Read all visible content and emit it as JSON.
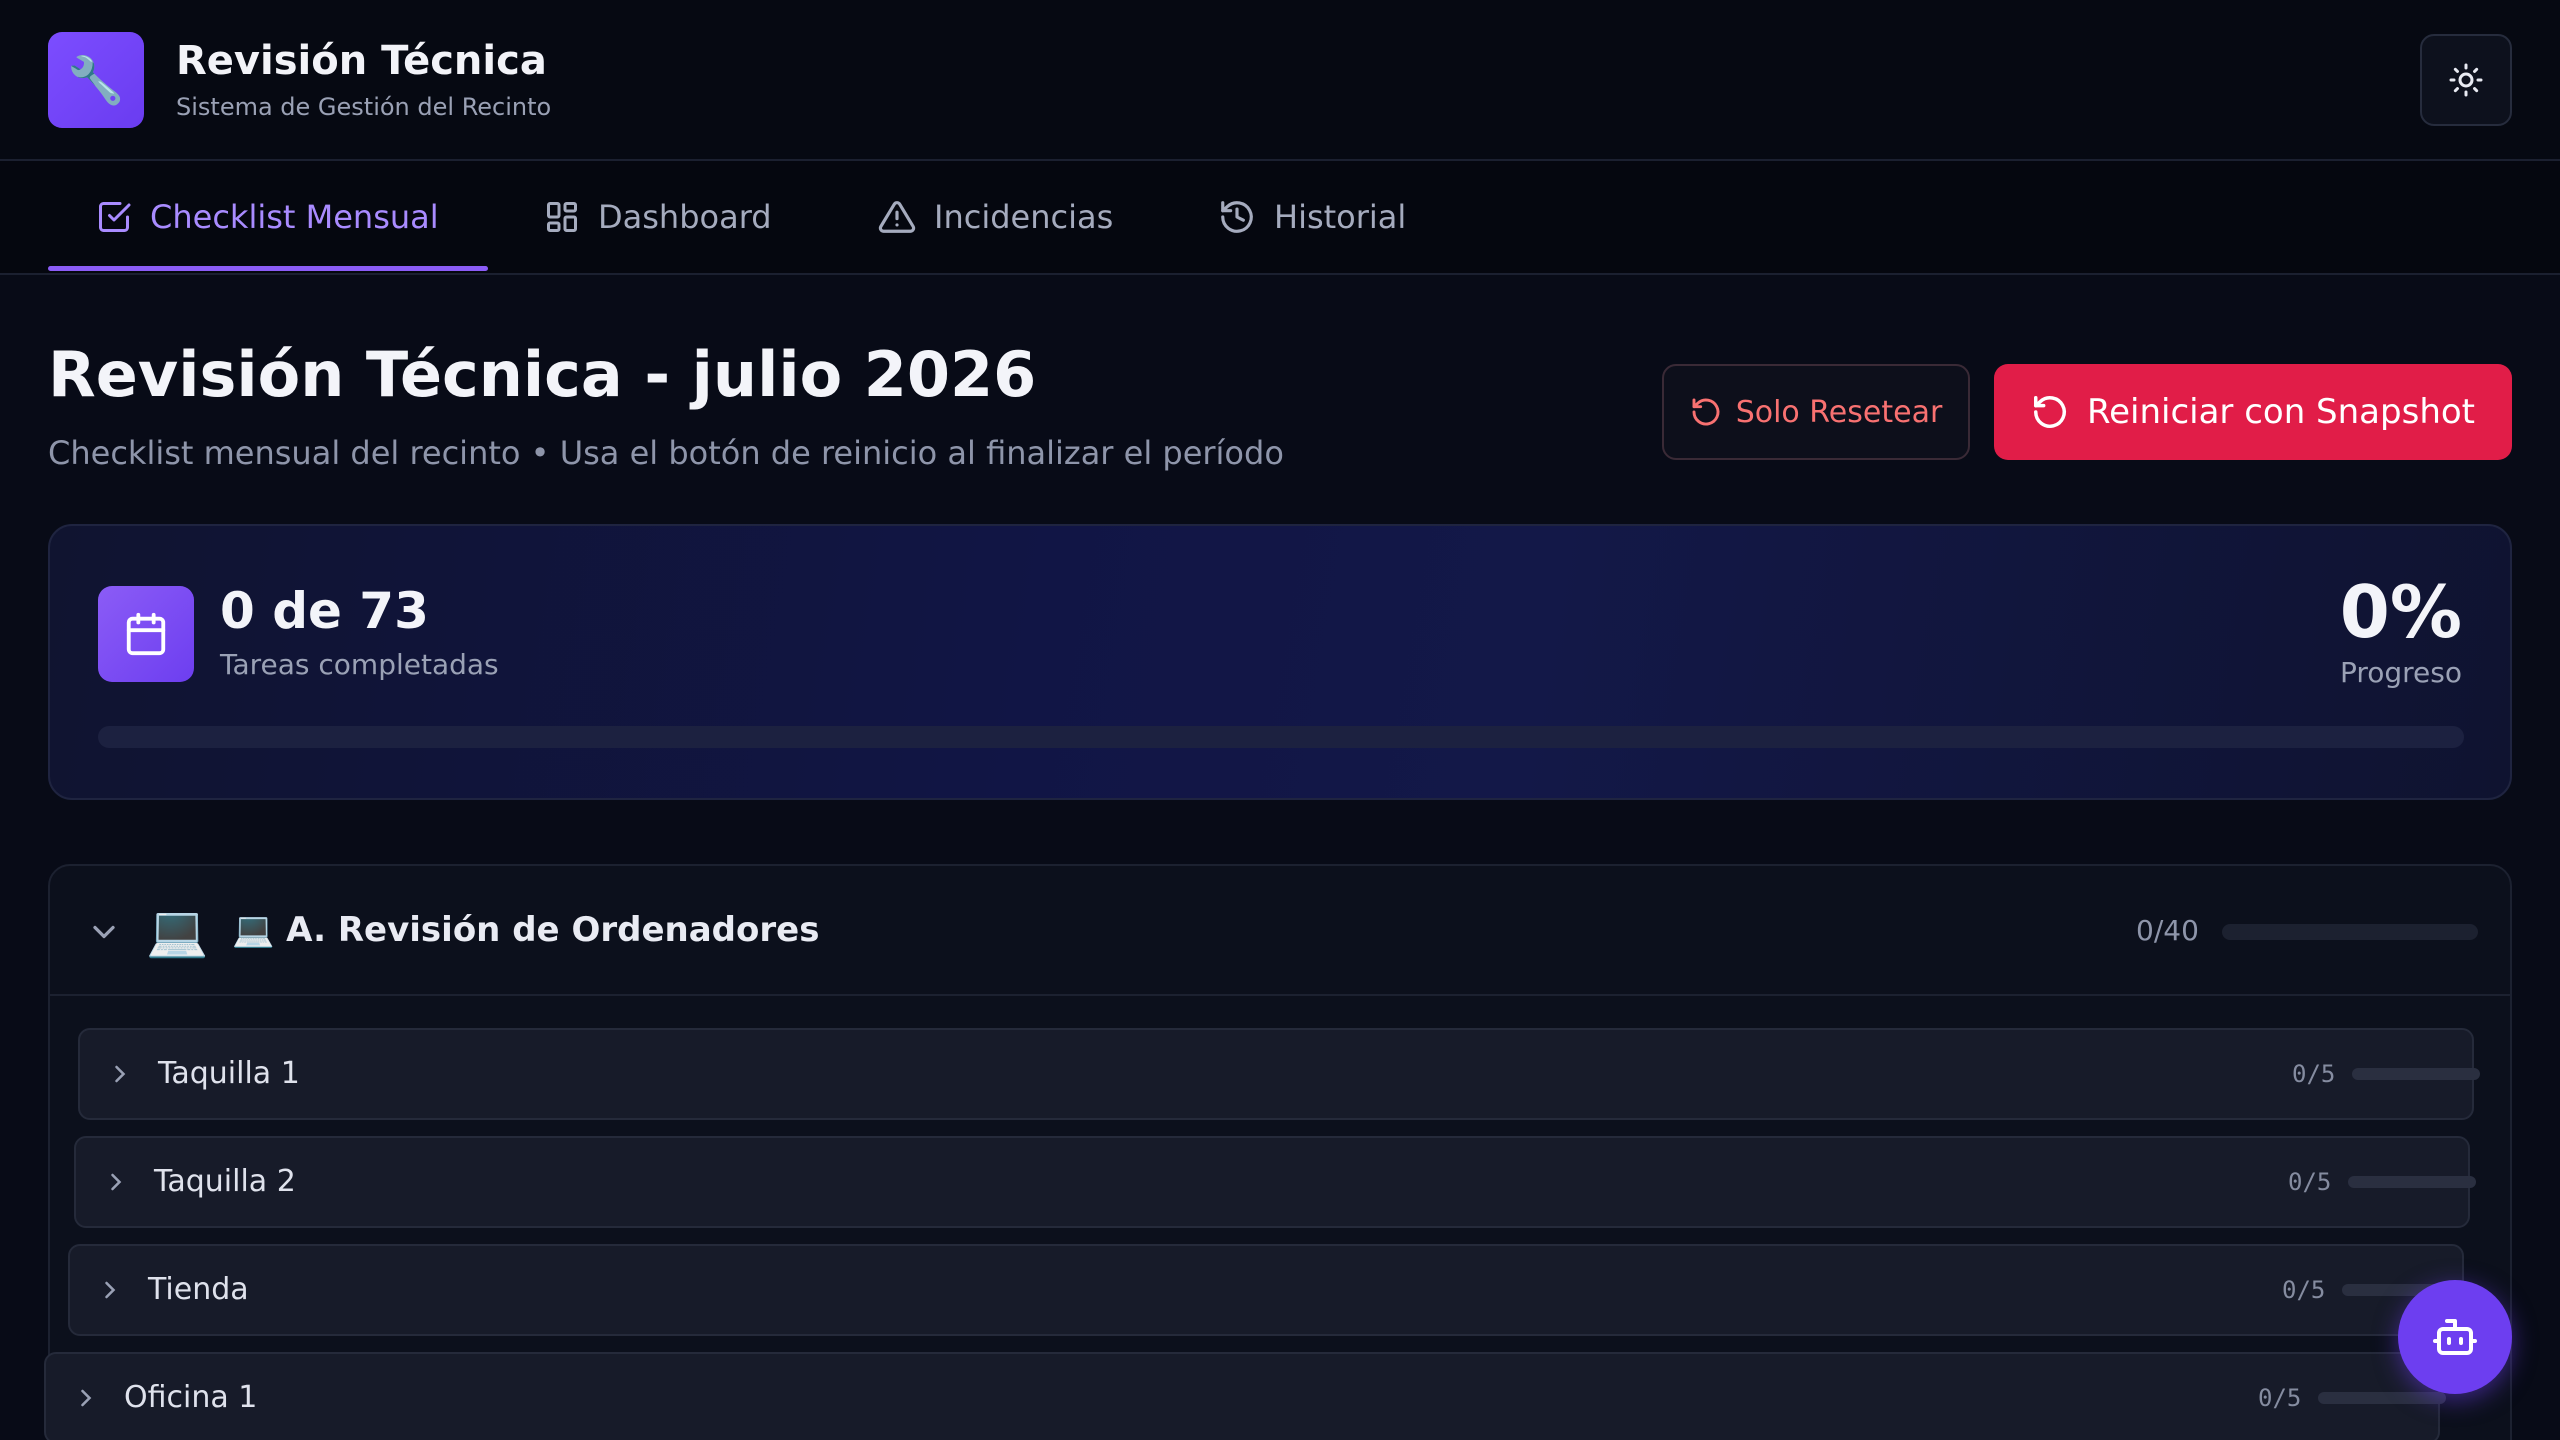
{
  "header": {
    "logo_glyph": "🔧",
    "title": "Revisión Técnica",
    "subtitle": "Sistema de Gestión del Recinto",
    "theme_icon": "sun-icon"
  },
  "tabs": [
    {
      "label": "Checklist Mensual",
      "icon": "checkbox-icon",
      "active": true
    },
    {
      "label": "Dashboard",
      "icon": "grid-icon",
      "active": false
    },
    {
      "label": "Incidencias",
      "icon": "warning-icon",
      "active": false
    },
    {
      "label": "Historial",
      "icon": "history-icon",
      "active": false
    }
  ],
  "page": {
    "title": "Revisión Técnica - julio 2026",
    "subtitle": "Checklist mensual del recinto • Usa el botón de reinicio al finalizar el período",
    "reset_label": "Solo Resetear",
    "snapshot_label": "Reiniciar con Snapshot"
  },
  "progress": {
    "done_text": "0 de 73",
    "done_label": "Tareas completadas",
    "percent_text": "0%",
    "percent_label": "Progreso",
    "fraction": 0
  },
  "section": {
    "emoji": "💻",
    "title": "💻 A. Revisión de Ordenadores",
    "count": "0/40",
    "fraction": 0,
    "rows": [
      {
        "label": "Taquilla 1",
        "count": "0/5",
        "fraction": 0
      },
      {
        "label": "Taquilla 2",
        "count": "0/5",
        "fraction": 0
      },
      {
        "label": "Tienda",
        "count": "0/5",
        "fraction": 0
      },
      {
        "label": "Oficina 1",
        "count": "0/5",
        "fraction": 0
      }
    ]
  },
  "colors": {
    "accent": "#8b5cf6",
    "danger": "#e11d48",
    "background": "#080b17"
  },
  "fab_icon": "bot-icon"
}
